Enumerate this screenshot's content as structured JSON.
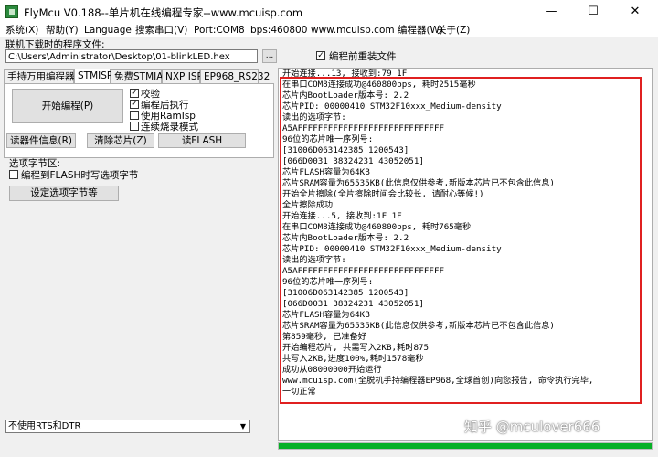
{
  "window": {
    "title": "FlyMcu V0.188--单片机在线编程专家--www.mcuisp.com",
    "minimize": "—",
    "maximize": "☐",
    "close": "✕"
  },
  "menu": [
    "系统(X)",
    "帮助(Y)",
    "Language",
    "搜索串口(V)",
    "Port:COM8",
    "bps:460800",
    "www.mcuisp.com 编程器(W)",
    "关于(Z)"
  ],
  "file": {
    "label": "联机下载时的程序文件:",
    "path": "C:\\Users\\Administrator\\Desktop\\01-blinkLED.hex",
    "browse": "...",
    "reload_label": "编程前重装文件",
    "reload_checked": true
  },
  "tabs": [
    "手持万用编程器",
    "STMISP",
    "免费STMIAP",
    "NXP ISP",
    "EP968_RS232"
  ],
  "active_tab": "STMISP",
  "stmisp": {
    "start_button": "开始编程(P)",
    "options": [
      {
        "label": "校验",
        "checked": true
      },
      {
        "label": "编程后执行",
        "checked": true
      },
      {
        "label": "使用RamIsp",
        "checked": false
      },
      {
        "label": "连续烧录模式",
        "checked": false
      }
    ],
    "read_info_button": "读器件信息(R)",
    "clear_chip_button": "清除芯片(Z)",
    "read_flash_button": "读FLASH"
  },
  "option_bytes": {
    "title": "选项字节区:",
    "write_label": "编程到FLASH时写选项字节",
    "write_checked": false,
    "set_button": "设定选项字节等"
  },
  "rts_dtr": {
    "value": "不使用RTS和DTR"
  },
  "log": {
    "lines": [
      "开始连接...13, 接收到:79 1F",
      "在串口COM8连接成功@460800bps, 耗时2515毫秒",
      "芯片内BootLoader版本号: 2.2",
      "芯片PID: 00000410  STM32F10xxx_Medium-density",
      "读出的选项字节:",
      "A5AFFFFFFFFFFFFFFFFFFFFFFFFFFFFF",
      "96位的芯片唯一序列号:",
      "[31006D063142385 1200543]",
      "[066D0031 38324231 43052051]",
      "芯片FLASH容量为64KB",
      "芯片SRAM容量为65535KB(此信息仅供参考,新版本芯片已不包含此信息)",
      "开始全片擦除(全片擦除时间会比较长, 请耐心等候!)",
      "全片擦除成功",
      "开始连接...5, 接收到:1F 1F",
      "在串口COM8连接成功@460800bps, 耗时765毫秒",
      "芯片内BootLoader版本号: 2.2",
      "芯片PID: 00000410  STM32F10xxx_Medium-density",
      "读出的选项字节:",
      "A5AFFFFFFFFFFFFFFFFFFFFFFFFFFFFF",
      "96位的芯片唯一序列号:",
      "[31006D063142385 1200543]",
      "[066D0031 38324231 43052051]",
      "芯片FLASH容量为64KB",
      "芯片SRAM容量为65535KB(此信息仅供参考,新版本芯片已不包含此信息)",
      "第859毫秒, 已准备好",
      "开始编程芯片, 共需写入2KB,耗时875",
      "共写入2KB,进度100%,耗时1578毫秒",
      "成功从08000000开始运行",
      "www.mcuisp.com(全脱机手持编程器EP968,全球首创)向您报告, 命令执行完毕,",
      "一切正常"
    ]
  },
  "watermark": "知乎 @mculover666",
  "progress": 1.0,
  "colors": {
    "highlight": "#e02020",
    "progress": "#06b025"
  }
}
